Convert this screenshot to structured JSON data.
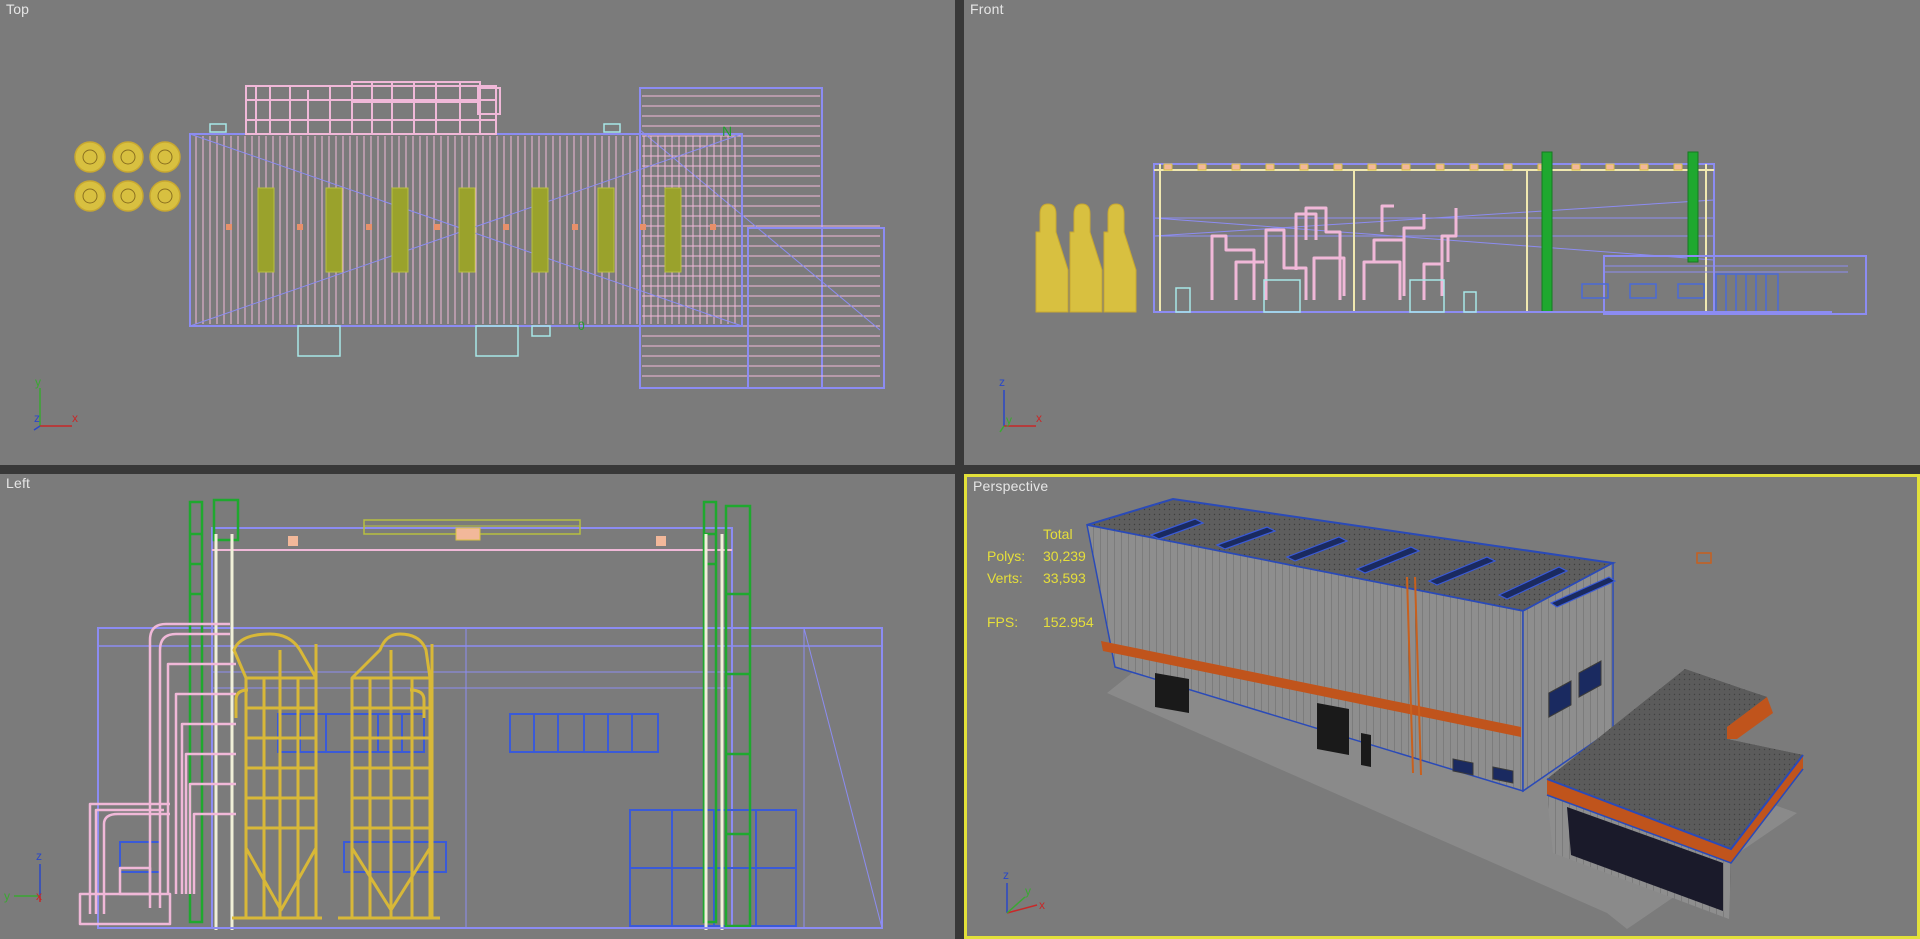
{
  "viewports": {
    "top": {
      "label": "Top",
      "axes": {
        "a": "y",
        "b": "z",
        "c": "x"
      }
    },
    "front": {
      "label": "Front",
      "axes": {
        "a": "z",
        "b": "y",
        "c": "x"
      }
    },
    "left": {
      "label": "Left",
      "axes": {
        "a": "z",
        "b": "y",
        "c": "x"
      }
    },
    "perspective": {
      "label": "Perspective",
      "active": true,
      "stats": {
        "total_label": "Total",
        "polys_label": "Polys:",
        "polys_value": "30,239",
        "verts_label": "Verts:",
        "verts_value": "33,593",
        "fps_label": "FPS:",
        "fps_value": "152.954"
      },
      "axes": {
        "a": "z",
        "b": "y",
        "c": "x"
      }
    }
  },
  "colors": {
    "viewport_bg": "#7b7b7b",
    "active_border": "#e2e03a",
    "wire_blue": "#8c8cf2",
    "wire_pink": "#f0b8d8",
    "wire_yellow": "#d8c040",
    "wire_green": "#1f9f2f",
    "stats_text": "#e6df3a"
  }
}
